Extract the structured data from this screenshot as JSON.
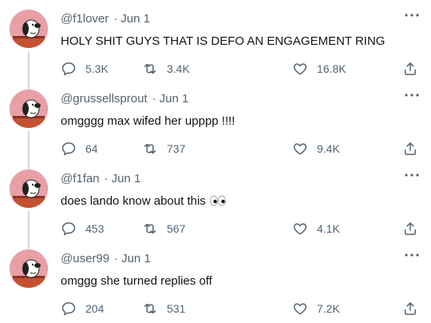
{
  "tweets": [
    {
      "handle": "@f1lover",
      "date": "Jun 1",
      "text": "HOLY SHIT GUYS THAT IS DEFO AN ENGAGEMENT RING",
      "replies": "5.3K",
      "retweets": "3.4K",
      "likes": "16.8K"
    },
    {
      "handle": "@grussellsprout",
      "date": "Jun 1",
      "text": "omgggg max wifed her upppp !!!!",
      "replies": "64",
      "retweets": "737",
      "likes": "9.4K"
    },
    {
      "handle": "@f1fan",
      "date": "Jun 1",
      "text": "does lando know about this",
      "emoji": "eyes-emoji",
      "replies": "453",
      "retweets": "567",
      "likes": "4.1K"
    },
    {
      "handle": "@user99",
      "date": "Jun 1",
      "text": "omggg she turned replies off",
      "replies": "204",
      "retweets": "531",
      "likes": "7.2K"
    }
  ],
  "header_separator": "·",
  "icons": {
    "reply": "reply-icon",
    "retweet": "retweet-icon",
    "like": "like-icon",
    "share": "share-icon",
    "more": "more-icon",
    "avatar": "snoopy-avatar"
  },
  "colors": {
    "text_primary": "#0f1419",
    "text_secondary": "#536471",
    "thread_line": "#cfd9de",
    "avatar_bg": "#e7a0a6"
  }
}
